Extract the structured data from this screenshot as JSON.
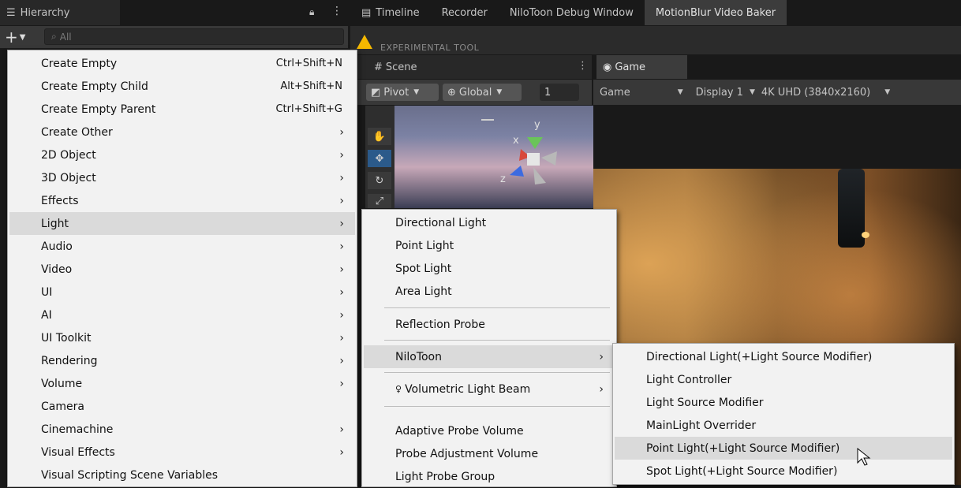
{
  "hierarchy": {
    "tab_label": "Hierarchy",
    "search_placeholder": "All"
  },
  "top_tabs": [
    "Timeline",
    "Recorder",
    "NiloToon Debug Window",
    "MotionBlur Video Baker"
  ],
  "experimental_text": "EXPERIMENTAL TOOL",
  "scene": {
    "tab_label": "Scene",
    "pivot_label": "Pivot",
    "global_label": "Global",
    "grid_value": "1",
    "axes": {
      "x": "x",
      "y": "y",
      "z": "z"
    }
  },
  "game": {
    "tab_label": "Game",
    "mode": "Game",
    "display": "Display 1",
    "resolution": "4K UHD (3840x2160)"
  },
  "create_menu": {
    "items": [
      {
        "label": "Create Empty",
        "shortcut": "Ctrl+Shift+N"
      },
      {
        "label": "Create Empty Child",
        "shortcut": "Alt+Shift+N"
      },
      {
        "label": "Create Empty Parent",
        "shortcut": "Ctrl+Shift+G"
      },
      {
        "label": "Create Other",
        "submenu": true
      },
      {
        "label": "2D Object",
        "submenu": true
      },
      {
        "label": "3D Object",
        "submenu": true
      },
      {
        "label": "Effects",
        "submenu": true
      },
      {
        "label": "Light",
        "submenu": true
      },
      {
        "label": "Audio",
        "submenu": true
      },
      {
        "label": "Video",
        "submenu": true
      },
      {
        "label": "UI",
        "submenu": true
      },
      {
        "label": "AI",
        "submenu": true
      },
      {
        "label": "UI Toolkit",
        "submenu": true
      },
      {
        "label": "Rendering",
        "submenu": true
      },
      {
        "label": "Volume",
        "submenu": true
      },
      {
        "label": "Camera"
      },
      {
        "label": "Cinemachine",
        "submenu": true
      },
      {
        "label": "Visual Effects",
        "submenu": true
      },
      {
        "label": "Visual Scripting Scene Variables"
      }
    ],
    "highlighted": "Light"
  },
  "light_menu": {
    "items": [
      {
        "label": "Directional Light"
      },
      {
        "label": "Point Light"
      },
      {
        "label": "Spot Light"
      },
      {
        "label": "Area Light"
      },
      {
        "label": "Reflection Probe"
      },
      {
        "label": "NiloToon",
        "submenu": true
      },
      {
        "label": "Volumetric Light Beam",
        "submenu": true
      },
      {
        "label": "Adaptive Probe Volume"
      },
      {
        "label": "Probe Adjustment Volume"
      },
      {
        "label": "Light Probe Group"
      }
    ],
    "highlighted": "NiloToon"
  },
  "nilotoon_menu": {
    "items": [
      {
        "label": "Directional Light(+Light Source Modifier)"
      },
      {
        "label": "Light Controller"
      },
      {
        "label": "Light Source Modifier"
      },
      {
        "label": "MainLight Overrider"
      },
      {
        "label": "Point Light(+Light Source Modifier)"
      },
      {
        "label": "Spot Light(+Light Source Modifier)"
      }
    ],
    "highlighted": "Point Light(+Light Source Modifier)"
  },
  "colors": {
    "menu_bg": "#f2f2f2",
    "menu_highlight": "#dadada",
    "editor_bg": "#191919",
    "warning": "#f5b800"
  }
}
